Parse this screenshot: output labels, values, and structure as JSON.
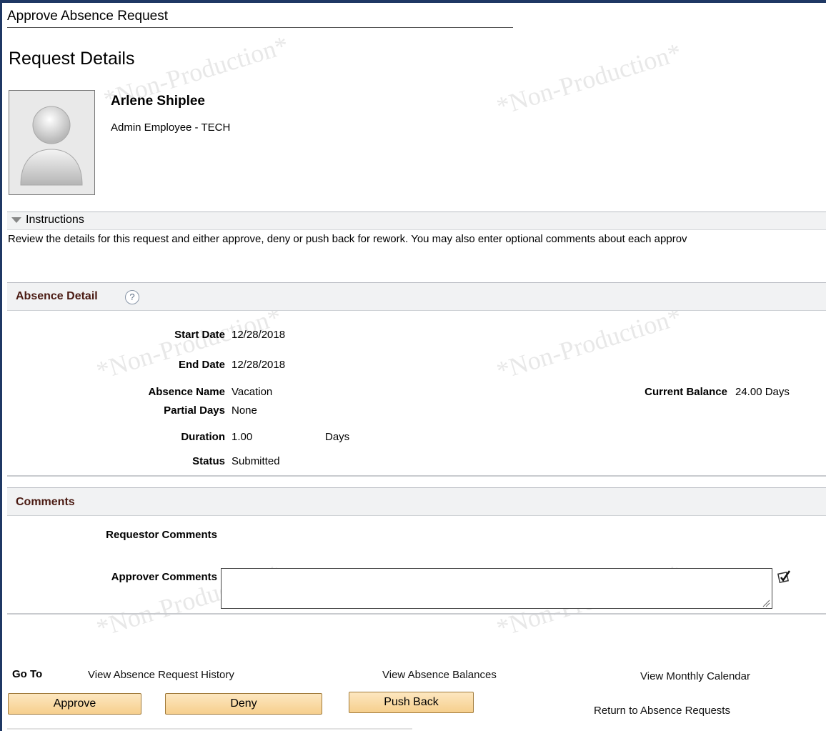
{
  "page": {
    "header": "Approve Absence Request",
    "section_title": "Request Details"
  },
  "employee": {
    "name": "Arlene Shiplee",
    "title": "Admin Employee - TECH",
    "photo_icon": "person-silhouette"
  },
  "instructions": {
    "label": "Instructions",
    "text": "Review the details for this request and either approve, deny or push back for rework. You may also enter optional comments about each approv"
  },
  "absence_detail": {
    "title": "Absence Detail",
    "help_icon": "?",
    "start_date_label": "Start Date",
    "start_date": "12/28/2018",
    "end_date_label": "End Date",
    "end_date": "12/28/2018",
    "absence_name_label": "Absence Name",
    "absence_name": "Vacation",
    "partial_days_label": "Partial Days",
    "partial_days": "None",
    "duration_label": "Duration",
    "duration": "1.00",
    "duration_unit": "Days",
    "status_label": "Status",
    "status": "Submitted",
    "current_balance_label": "Current Balance",
    "current_balance": "24.00 Days"
  },
  "comments": {
    "title": "Comments",
    "requestor_label": "Requestor Comments",
    "approver_label": "Approver Comments",
    "approver_value": ""
  },
  "go_to": {
    "label": "Go To",
    "history_link": "View Absence Request History",
    "balances_link": "View Absence Balances",
    "calendar_link": "View Monthly Calendar",
    "return_link": "Return to Absence Requests"
  },
  "actions": {
    "approve": "Approve",
    "deny": "Deny",
    "push_back": "Push Back"
  },
  "watermark": "*Non-Production*",
  "colors": {
    "frame": "#1f3864",
    "group_title": "#4a1a12",
    "button": "#f6cf8d"
  }
}
